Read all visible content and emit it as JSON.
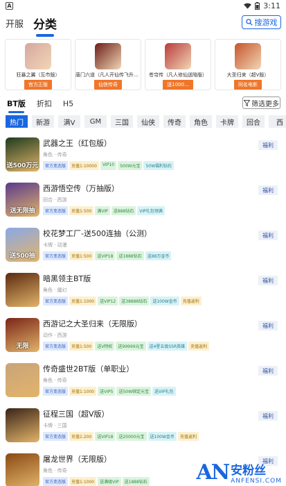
{
  "status_bar": {
    "left_icon": "A",
    "time": "3:11"
  },
  "top_tabs": [
    {
      "label": "开服"
    },
    {
      "label": "分类"
    }
  ],
  "search_button": {
    "label": "搜游戏"
  },
  "featured": [
    {
      "name": "狂暴之翼（互市版）",
      "badge": "官方正版",
      "color": "#d6a7a0"
    },
    {
      "name": "唐门六道（凡人开仙传飞升版）",
      "badge": "仙侠传奇",
      "color": "#6b1d18"
    },
    {
      "name": "苍穹传（凡人修仙送陪版）",
      "badge": "送1000...",
      "color": "#b83b3b"
    },
    {
      "name": "大圣归来（超V版）",
      "badge": "同名电影",
      "color": "#c4552a"
    }
  ],
  "sub_tabs": [
    {
      "label": "BT版"
    },
    {
      "label": "折扣"
    },
    {
      "label": "H5"
    }
  ],
  "filter_button": {
    "label": "筛选更多"
  },
  "categories": [
    "热门",
    "新游",
    "满V",
    "GM",
    "三国",
    "仙侠",
    "传奇",
    "角色",
    "卡牌",
    "回合",
    "西"
  ],
  "welfare_label": "福利",
  "games": [
    {
      "title": "武器之王（红包版）",
      "type": "角色 · 传奇",
      "icon_color": "#1e3b1e",
      "icon_text": "送500万元",
      "tags": [
        {
          "text": "官方变态版",
          "c": "blue"
        },
        {
          "text": "充值1:10000",
          "c": "yellow"
        },
        {
          "text": "VIP10",
          "c": "green"
        },
        {
          "text": "500W元宝",
          "c": "green"
        },
        {
          "text": "50W福利钻石",
          "c": "cyan"
        }
      ]
    },
    {
      "title": "西游悟空传（万抽版）",
      "type": "回合 · 西游",
      "icon_color": "#5a3a8c",
      "icon_text": "送无限抽",
      "tags": [
        {
          "text": "官方变态版",
          "c": "blue"
        },
        {
          "text": "充值1:500",
          "c": "yellow"
        },
        {
          "text": "满VIP",
          "c": "green"
        },
        {
          "text": "送888钻石",
          "c": "green"
        },
        {
          "text": "VIP礼包领满",
          "c": "cyan"
        }
      ]
    },
    {
      "title": "校花梦工厂-送500连抽（公测）",
      "type": "卡牌 · 动漫",
      "icon_color": "#8aa8e6",
      "icon_text": "送500抽",
      "tags": [
        {
          "text": "官方变态版",
          "c": "blue"
        },
        {
          "text": "充值1:500",
          "c": "yellow"
        },
        {
          "text": "送VIP18",
          "c": "green"
        },
        {
          "text": "送1888钻石",
          "c": "green"
        },
        {
          "text": "送88万金币",
          "c": "cyan"
        }
      ]
    },
    {
      "title": "暗黑领主BT版",
      "type": "角色 · 魔幻",
      "icon_color": "#5a2a10",
      "icon_text": "",
      "tags": [
        {
          "text": "官方变态版",
          "c": "blue"
        },
        {
          "text": "充值1:1000",
          "c": "yellow"
        },
        {
          "text": "送VIP12",
          "c": "green"
        },
        {
          "text": "送38888钻石",
          "c": "green"
        },
        {
          "text": "送100W金币",
          "c": "cyan"
        },
        {
          "text": "充值返利",
          "c": "yellow"
        }
      ]
    },
    {
      "title": "西游记之大圣归来（无限版）",
      "type": "动作 · 西游",
      "icon_color": "#7a2518",
      "icon_text": "无限",
      "tags": [
        {
          "text": "官方变态版",
          "c": "blue"
        },
        {
          "text": "充值1:500",
          "c": "yellow"
        },
        {
          "text": "送V特权",
          "c": "green"
        },
        {
          "text": "送99999元宝",
          "c": "green"
        },
        {
          "text": "送4星五级SSR英雄",
          "c": "cyan"
        },
        {
          "text": "充值返利",
          "c": "yellow"
        }
      ]
    },
    {
      "title": "传奇盛世2BT版（单职业）",
      "type": "角色 · 传奇",
      "icon_color": "#c9a47a",
      "icon_text": "",
      "tags": [
        {
          "text": "官方变态版",
          "c": "blue"
        },
        {
          "text": "充值1:1000",
          "c": "yellow"
        },
        {
          "text": "送VIP5",
          "c": "green"
        },
        {
          "text": "送50W绑定元宝",
          "c": "green"
        },
        {
          "text": "送VIP礼包",
          "c": "cyan"
        }
      ]
    },
    {
      "title": "征程三国（超V版）",
      "type": "卡牌 · 三国",
      "icon_color": "#3a2418",
      "icon_text": "",
      "tags": [
        {
          "text": "官方变态版",
          "c": "blue"
        },
        {
          "text": "充值1:200",
          "c": "yellow"
        },
        {
          "text": "送VIP18",
          "c": "green"
        },
        {
          "text": "送20000元宝",
          "c": "green"
        },
        {
          "text": "送100W金币",
          "c": "cyan"
        },
        {
          "text": "充值返利",
          "c": "yellow"
        }
      ]
    },
    {
      "title": "屠龙世界（无限版）",
      "type": "角色 · 传奇",
      "icon_color": "#8a4a14",
      "icon_text": "",
      "tags": [
        {
          "text": "官方变态版",
          "c": "blue"
        },
        {
          "text": "充值1:1000",
          "c": "yellow"
        },
        {
          "text": "送满级VIP",
          "c": "green"
        },
        {
          "text": "送1888钻石",
          "c": "green"
        }
      ]
    }
  ],
  "watermark": {
    "logo": "AN",
    "cn": "安粉丝",
    "en": "ANFENSI.COM"
  }
}
